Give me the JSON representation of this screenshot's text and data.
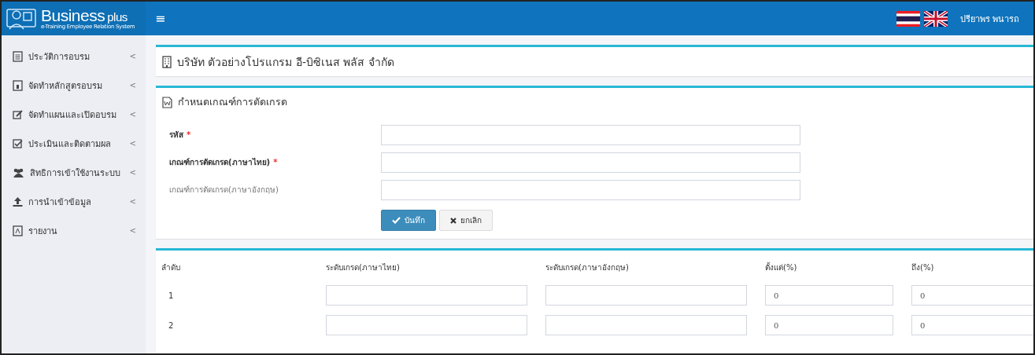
{
  "header": {
    "brand": "Business",
    "brand_suffix": "plus",
    "tagline": "e-Training Employee Relation System",
    "menu_toggle": "≡",
    "user_name": "ปรียาพร พนารถ"
  },
  "sidebar": {
    "items": [
      {
        "label": "ประวัติการอบรม",
        "caret": "<"
      },
      {
        "label": "จัดทำหลักสูตรอบรม",
        "caret": "<"
      },
      {
        "label": "จัดทำแผนและเปิดอบรม",
        "caret": "<"
      },
      {
        "label": "ประเมินและติดตามผล",
        "caret": "<"
      },
      {
        "label": "สิทธิการเข้าใช้งานระบบ",
        "caret": "<"
      },
      {
        "label": "การนำเข้าข้อมูล",
        "caret": "<"
      },
      {
        "label": "รายงาน",
        "caret": "<"
      }
    ]
  },
  "company": {
    "title": "บริษัท ตัวอย่างโปรแกรม อี-บิซิเนส พลัส จำกัด"
  },
  "form": {
    "title": "กำหนดเกณฑ์การตัดเกรด",
    "required_mark": "*",
    "fields": [
      {
        "label": "รหัส",
        "required": true
      },
      {
        "label": "เกณฑ์การตัดเกรด(ภาษาไทย)",
        "required": true
      },
      {
        "label": "เกณฑ์การตัดเกรด(ภาษาอังกฤษ)",
        "required": false
      }
    ],
    "buttons": [
      {
        "label": "บันทึก",
        "kind": "primary"
      },
      {
        "label": "ยกเลิก",
        "kind": "default"
      }
    ]
  },
  "table": {
    "columns": [
      "ลำดับ",
      "ระดับเกรด(ภาษาไทย)",
      "ระดับเกรด(ภาษาอังกฤษ)",
      "ตั้งแต่(%)",
      "ถึง(%)"
    ],
    "rows": [
      {
        "order": "1",
        "from": "0",
        "to": "0"
      },
      {
        "order": "2",
        "from": "0",
        "to": "0"
      }
    ]
  }
}
